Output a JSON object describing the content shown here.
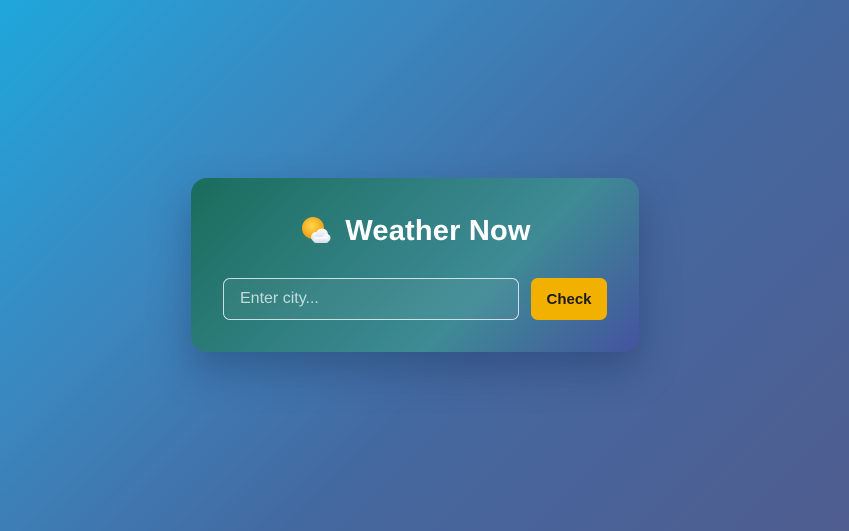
{
  "app": {
    "title": "Weather Now",
    "title_icon": "sun-behind-cloud-icon"
  },
  "search": {
    "placeholder": "Enter city...",
    "value": "",
    "button_label": "Check"
  },
  "colors": {
    "button_background": "#f2b000",
    "title_text": "#ffffff"
  }
}
